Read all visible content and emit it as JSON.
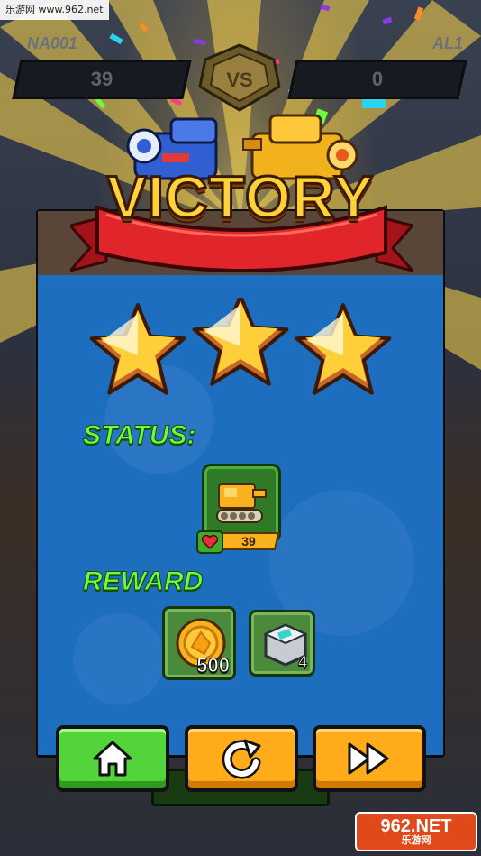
{
  "watermark_top": "乐游网 www.962.net",
  "players": {
    "left": {
      "name": "NA001",
      "score": "39"
    },
    "right": {
      "name": "AL1",
      "score": "0"
    }
  },
  "vs_label": "VS",
  "title": "VICTORY",
  "stars": {
    "earned": 3,
    "total": 3
  },
  "status": {
    "label": "STATUS:",
    "unit_hp": "39",
    "unit_icon": "yellow-tank-icon",
    "hp_icon": "heart-icon"
  },
  "reward": {
    "label": "REWARD",
    "items": [
      {
        "icon": "gold-coin-icon",
        "count": "500"
      },
      {
        "icon": "supply-crate-icon",
        "count": "4"
      }
    ]
  },
  "buttons": {
    "home_icon": "home-icon",
    "retry_icon": "retry-icon",
    "next_icon": "fast-forward-icon"
  },
  "watermark_bottom": {
    "top": "962.NET",
    "bottom": "乐游网"
  },
  "colors": {
    "victory_gold": "#ffd23a",
    "ribbon_red": "#e0262a",
    "label_green": "#6aff3a",
    "panel_blue": "#1e6ec0",
    "home_green": "#53d43a",
    "button_orange": "#ffab1a"
  }
}
